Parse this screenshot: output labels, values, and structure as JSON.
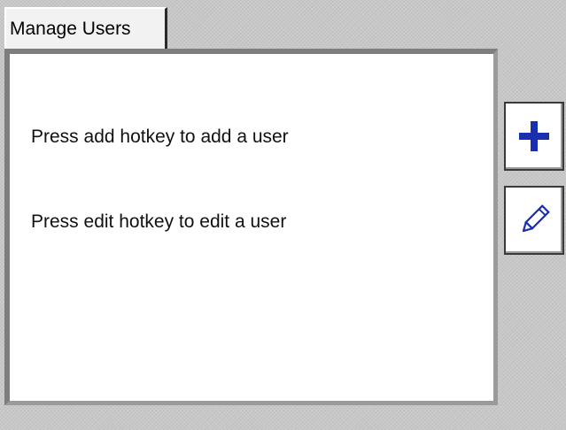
{
  "tab": {
    "label": "Manage Users"
  },
  "content": {
    "add_hint": "Press add hotkey to add a user",
    "edit_hint": "Press edit hotkey to edit a user"
  },
  "hotkeys": [
    {
      "name": "add",
      "icon": "plus-icon"
    },
    {
      "name": "edit",
      "icon": "pencil-icon"
    }
  ],
  "colors": {
    "icon_blue": "#1a2fb0",
    "background": "#c8c8c8",
    "panel": "#ffffff"
  }
}
